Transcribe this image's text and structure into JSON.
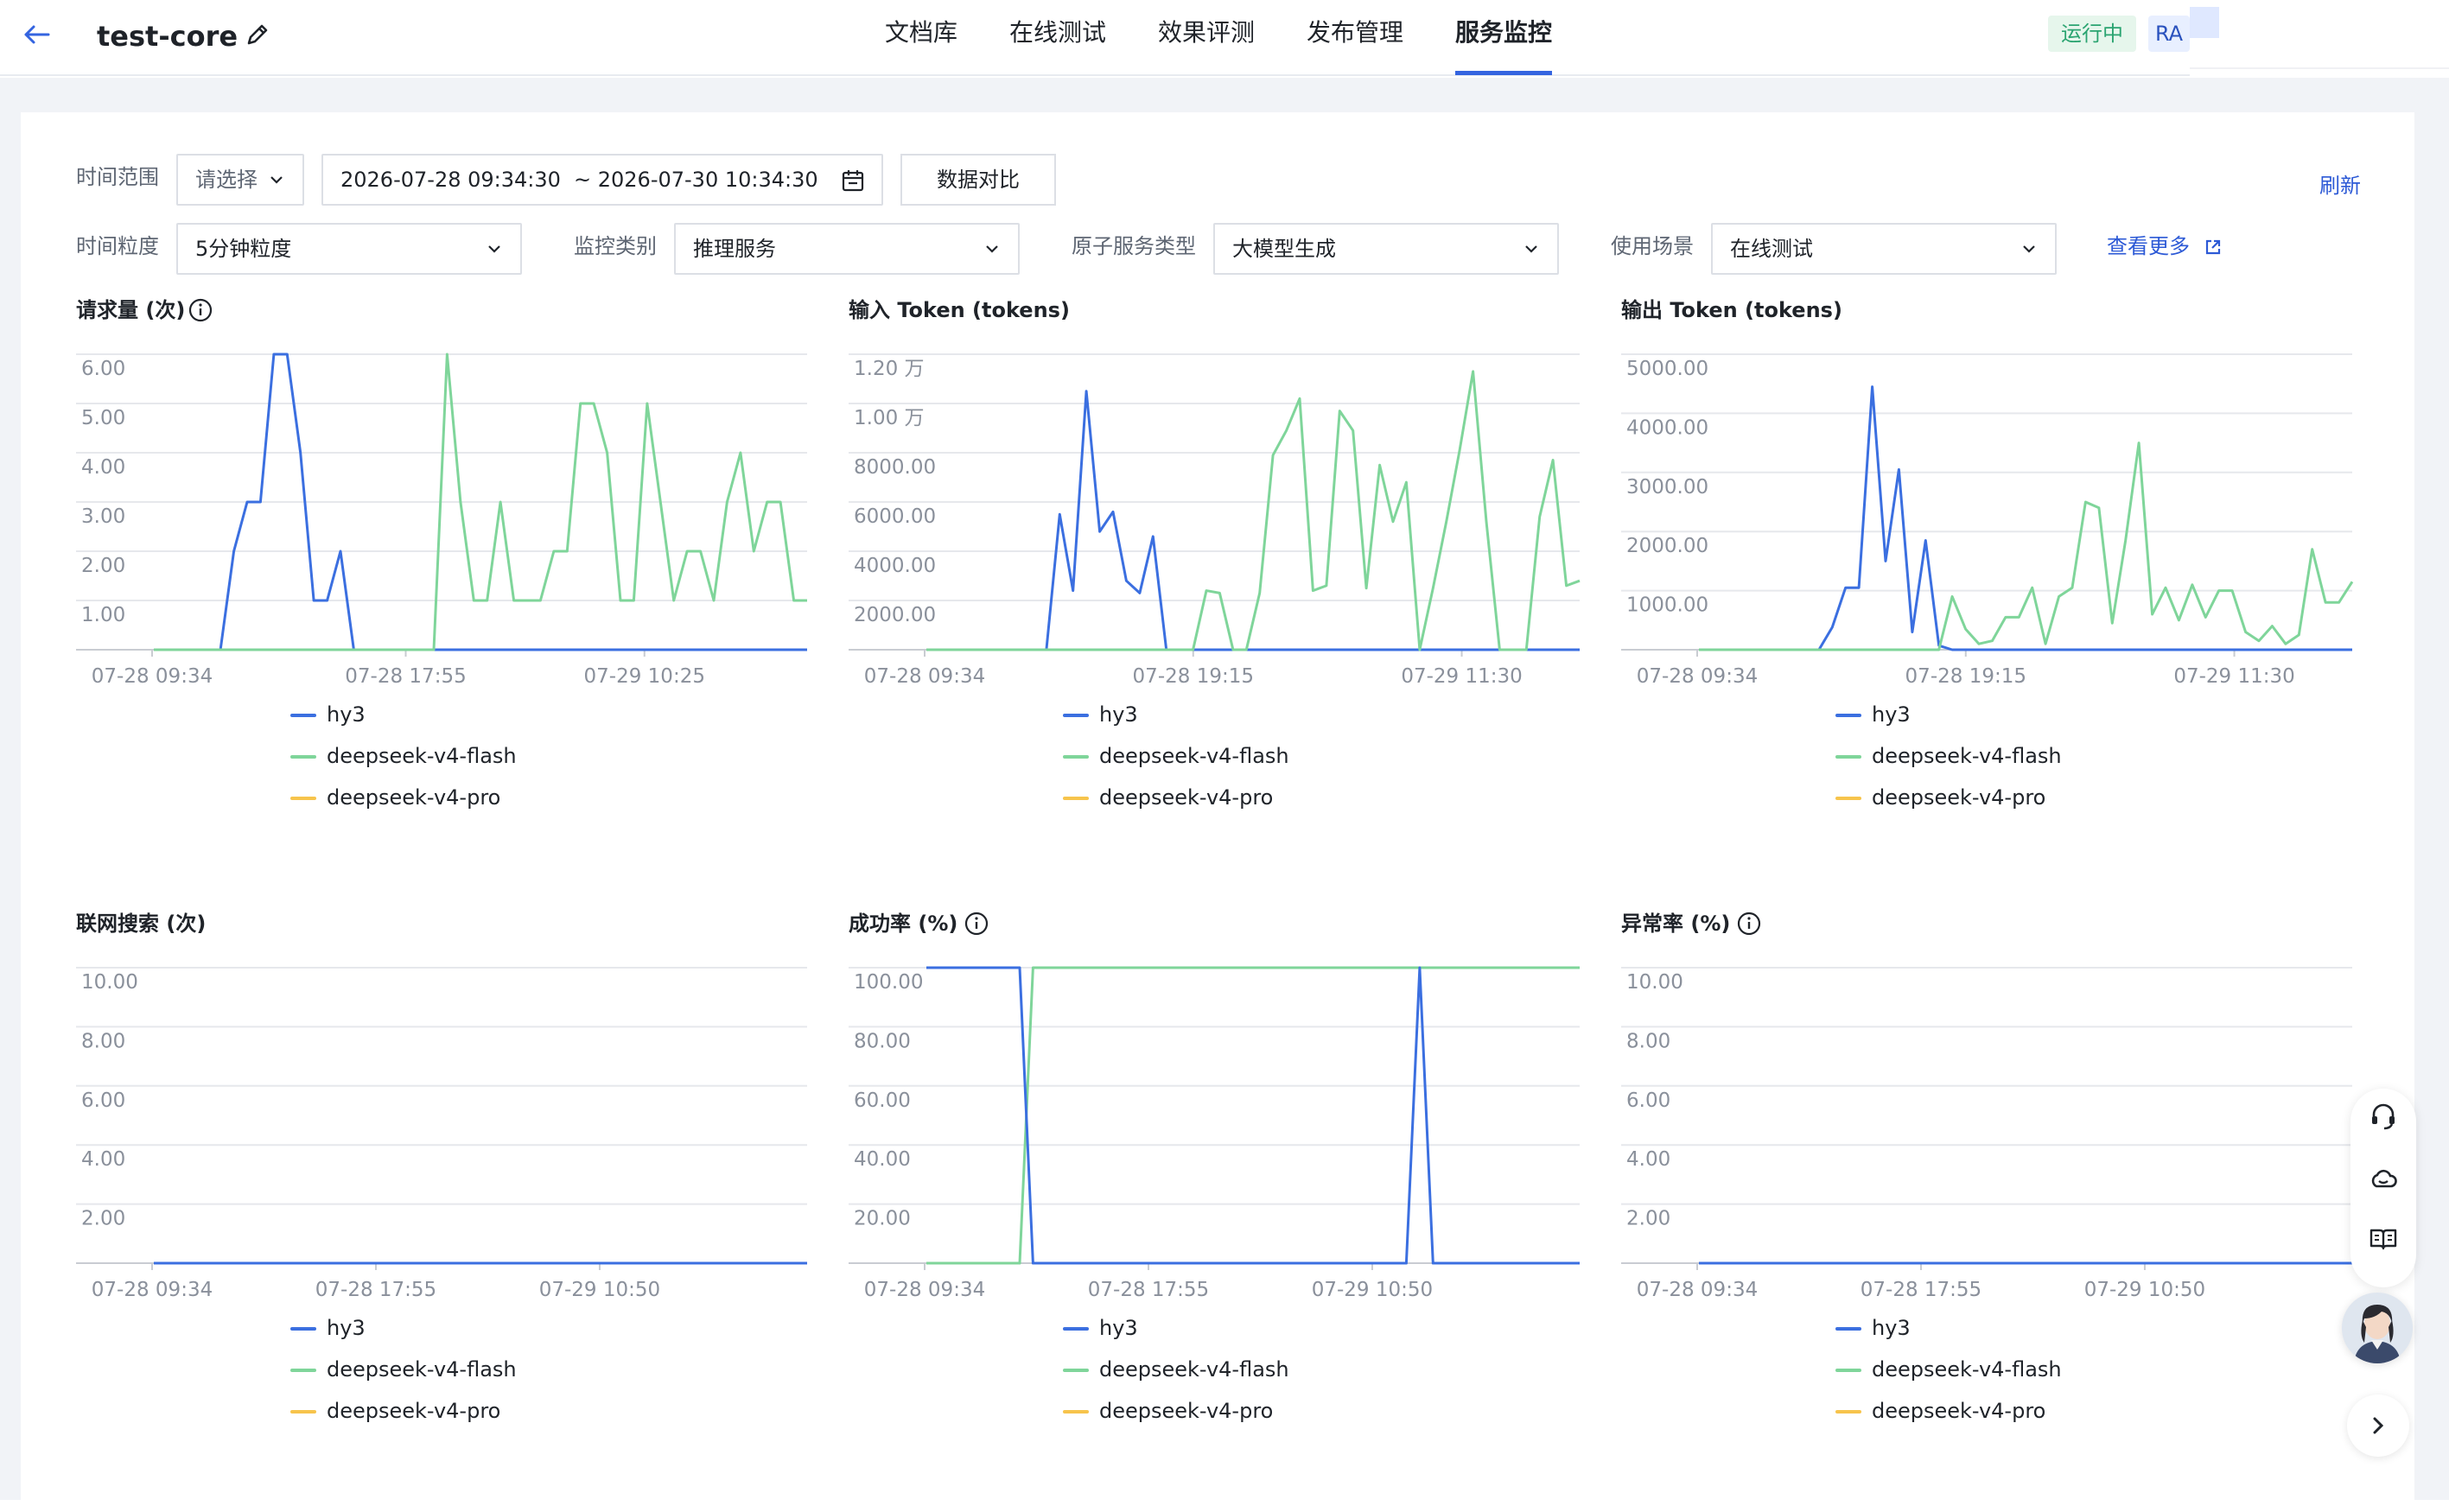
{
  "header": {
    "app_title": "test-core",
    "tabs": [
      {
        "label": "文档库"
      },
      {
        "label": "在线测试"
      },
      {
        "label": "效果评测"
      },
      {
        "label": "发布管理"
      },
      {
        "label": "服务监控"
      }
    ],
    "active_tab": "服务监控",
    "status": "运行中",
    "badge": "RA",
    "accent_color": "#3464e0"
  },
  "filters": {
    "time_range_label": "时间范围",
    "time_range_select": "请选择",
    "date_start": "2026-07-28 09:34:30",
    "date_end": "~ 2026-07-30 10:34:30",
    "compare_button": "数据对比",
    "refresh": "刷新",
    "granularity_label": "时间粒度",
    "granularity_value": "5分钟粒度",
    "category_label": "监控类别",
    "category_value": "推理服务",
    "atomic_label": "原子服务类型",
    "atomic_value": "大模型生成",
    "scene_label": "使用场景",
    "scene_value": "在线测试",
    "more_link": "查看更多"
  },
  "legend": [
    {
      "name": "hy3",
      "color": "#3b6fe0"
    },
    {
      "name": "deepseek-v4-flash",
      "color": "#7fd59a"
    },
    {
      "name": "deepseek-v4-pro",
      "color": "#f7c44c"
    }
  ],
  "chart_data": [
    {
      "type": "line",
      "title": "请求量 (次)",
      "y_ticks": [
        "6.00",
        "5.00",
        "4.00",
        "3.00",
        "2.00",
        "1.00"
      ],
      "ylim": [
        0,
        6
      ],
      "x_tick_labels": [
        "07-28 09:34",
        "07-28 17:55",
        "07-29 10:25"
      ],
      "x_tick_index": [
        0,
        17,
        33
      ],
      "n_points": 50,
      "series": [
        {
          "name": "hy3",
          "values": [
            0,
            0,
            0,
            0,
            0,
            0,
            2,
            3,
            3,
            6,
            6,
            4,
            1,
            1,
            2,
            0,
            0,
            0,
            0,
            0,
            0,
            0,
            0,
            0,
            0,
            0,
            0,
            0,
            0,
            0,
            0,
            0,
            0,
            0,
            0,
            0,
            0,
            0,
            0,
            0,
            0,
            0,
            0,
            0,
            0,
            0,
            0,
            0,
            0,
            0
          ]
        },
        {
          "name": "deepseek-v4-flash",
          "values": [
            0,
            0,
            0,
            0,
            0,
            0,
            0,
            0,
            0,
            0,
            0,
            0,
            0,
            0,
            0,
            0,
            0,
            0,
            0,
            0,
            0,
            0,
            6,
            3,
            1,
            1,
            3,
            1,
            1,
            1,
            2,
            2,
            5,
            5,
            4,
            1,
            1,
            5,
            3,
            1,
            2,
            2,
            1,
            3,
            4,
            2,
            3,
            3,
            1,
            1
          ]
        }
      ]
    },
    {
      "type": "line",
      "title": "输入 Token (tokens)",
      "y_ticks": [
        "1.20 万",
        "1.00 万",
        "8000.00",
        "6000.00",
        "4000.00",
        "2000.00"
      ],
      "ylim": [
        0,
        12000
      ],
      "x_tick_labels": [
        "07-28 09:34",
        "07-28 19:15",
        "07-29 11:30"
      ],
      "x_tick_index": [
        0,
        18,
        36
      ],
      "n_points": 50,
      "series": [
        {
          "name": "hy3",
          "values": [
            0,
            0,
            0,
            0,
            0,
            0,
            0,
            0,
            0,
            0,
            5500,
            2400,
            10500,
            4800,
            5600,
            2800,
            2300,
            4600,
            0,
            0,
            0,
            0,
            0,
            0,
            0,
            0,
            0,
            0,
            0,
            0,
            0,
            0,
            0,
            0,
            0,
            0,
            0,
            0,
            0,
            0,
            0,
            0,
            0,
            0,
            0,
            0,
            0,
            0,
            0,
            0
          ]
        },
        {
          "name": "deepseek-v4-flash",
          "values": [
            0,
            0,
            0,
            0,
            0,
            0,
            0,
            0,
            0,
            0,
            0,
            0,
            0,
            0,
            0,
            0,
            0,
            0,
            0,
            0,
            0,
            2400,
            2300,
            0,
            0,
            2300,
            7900,
            8900,
            10200,
            2400,
            2600,
            9700,
            8900,
            2500,
            7500,
            5200,
            6800,
            0,
            2500,
            5200,
            8100,
            11300,
            5200,
            0,
            0,
            0,
            5400,
            7700,
            2600,
            2800
          ]
        }
      ]
    },
    {
      "type": "line",
      "title": "输出 Token (tokens)",
      "y_ticks": [
        "5000.00",
        "4000.00",
        "3000.00",
        "2000.00",
        "1000.00"
      ],
      "ylim": [
        0,
        5000
      ],
      "x_tick_labels": [
        "07-28 09:34",
        "07-28 19:15",
        "07-29 11:30"
      ],
      "x_tick_index": [
        0,
        18,
        36
      ],
      "n_points": 50,
      "series": [
        {
          "name": "hy3",
          "values": [
            0,
            0,
            0,
            0,
            0,
            0,
            0,
            0,
            0,
            0,
            380,
            1050,
            1050,
            4450,
            1500,
            3050,
            300,
            1850,
            70,
            0,
            0,
            0,
            0,
            0,
            0,
            0,
            0,
            0,
            0,
            0,
            0,
            0,
            0,
            0,
            0,
            0,
            0,
            0,
            0,
            0,
            0,
            0,
            0,
            0,
            0,
            0,
            0,
            0,
            0,
            0
          ]
        },
        {
          "name": "deepseek-v4-flash",
          "values": [
            0,
            0,
            0,
            0,
            0,
            0,
            0,
            0,
            0,
            0,
            0,
            0,
            0,
            0,
            0,
            0,
            0,
            0,
            0,
            900,
            350,
            100,
            150,
            550,
            550,
            1050,
            100,
            900,
            1050,
            2500,
            2400,
            450,
            1850,
            3500,
            600,
            1050,
            500,
            1100,
            550,
            1000,
            1000,
            300,
            150,
            400,
            100,
            250,
            1700,
            800,
            800,
            1150
          ]
        }
      ]
    },
    {
      "type": "line",
      "title": "联网搜索 (次)",
      "y_ticks": [
        "10.00",
        "8.00",
        "6.00",
        "4.00",
        "2.00"
      ],
      "ylim": [
        0,
        10
      ],
      "x_tick_labels": [
        "07-28 09:34",
        "07-28 17:55",
        "07-29 10:50"
      ],
      "x_tick_index": [
        0,
        15,
        30
      ],
      "n_points": 50,
      "series": [
        {
          "name": "hy3",
          "values": [
            0,
            0,
            0,
            0,
            0,
            0,
            0,
            0,
            0,
            0,
            0,
            0,
            0,
            0,
            0,
            0,
            0,
            0,
            0,
            0,
            0,
            0,
            0,
            0,
            0,
            0,
            0,
            0,
            0,
            0,
            0,
            0,
            0,
            0,
            0,
            0,
            0,
            0,
            0,
            0,
            0,
            0,
            0,
            0,
            0,
            0,
            0,
            0,
            0,
            0
          ]
        }
      ]
    },
    {
      "type": "line",
      "title": "成功率 (%)",
      "y_ticks": [
        "100.00",
        "80.00",
        "60.00",
        "40.00",
        "20.00"
      ],
      "ylim": [
        0,
        100
      ],
      "x_tick_labels": [
        "07-28 09:34",
        "07-28 17:55",
        "07-29 10:50"
      ],
      "x_tick_index": [
        0,
        15,
        30
      ],
      "n_points": 50,
      "series": [
        {
          "name": "deepseek-v4-flash",
          "values": [
            0,
            0,
            0,
            0,
            0,
            0,
            0,
            0,
            100,
            100,
            100,
            100,
            100,
            100,
            100,
            100,
            100,
            100,
            100,
            100,
            100,
            100,
            100,
            100,
            100,
            100,
            100,
            100,
            100,
            100,
            100,
            100,
            100,
            100,
            100,
            100,
            100,
            100,
            100,
            100,
            100,
            100,
            100,
            100,
            100,
            100,
            100,
            100,
            100,
            100
          ]
        },
        {
          "name": "hy3",
          "values": [
            100,
            100,
            100,
            100,
            100,
            100,
            100,
            100,
            0,
            0,
            0,
            0,
            0,
            0,
            0,
            0,
            0,
            0,
            0,
            0,
            0,
            0,
            0,
            0,
            0,
            0,
            0,
            0,
            0,
            0,
            0,
            0,
            0,
            0,
            0,
            0,
            0,
            100,
            0,
            0,
            0,
            0,
            0,
            0,
            0,
            0,
            0,
            0,
            0,
            0
          ]
        }
      ]
    },
    {
      "type": "line",
      "title": "异常率 (%)",
      "y_ticks": [
        "10.00",
        "8.00",
        "6.00",
        "4.00",
        "2.00"
      ],
      "ylim": [
        0,
        10
      ],
      "x_tick_labels": [
        "07-28 09:34",
        "07-28 17:55",
        "07-29 10:50"
      ],
      "x_tick_index": [
        0,
        15,
        30
      ],
      "n_points": 50,
      "series": [
        {
          "name": "hy3",
          "values": [
            0,
            0,
            0,
            0,
            0,
            0,
            0,
            0,
            0,
            0,
            0,
            0,
            0,
            0,
            0,
            0,
            0,
            0,
            0,
            0,
            0,
            0,
            0,
            0,
            0,
            0,
            0,
            0,
            0,
            0,
            0,
            0,
            0,
            0,
            0,
            0,
            0,
            0,
            0,
            0,
            0,
            0,
            0,
            0,
            0,
            0,
            0,
            0,
            0,
            0
          ]
        }
      ]
    }
  ]
}
